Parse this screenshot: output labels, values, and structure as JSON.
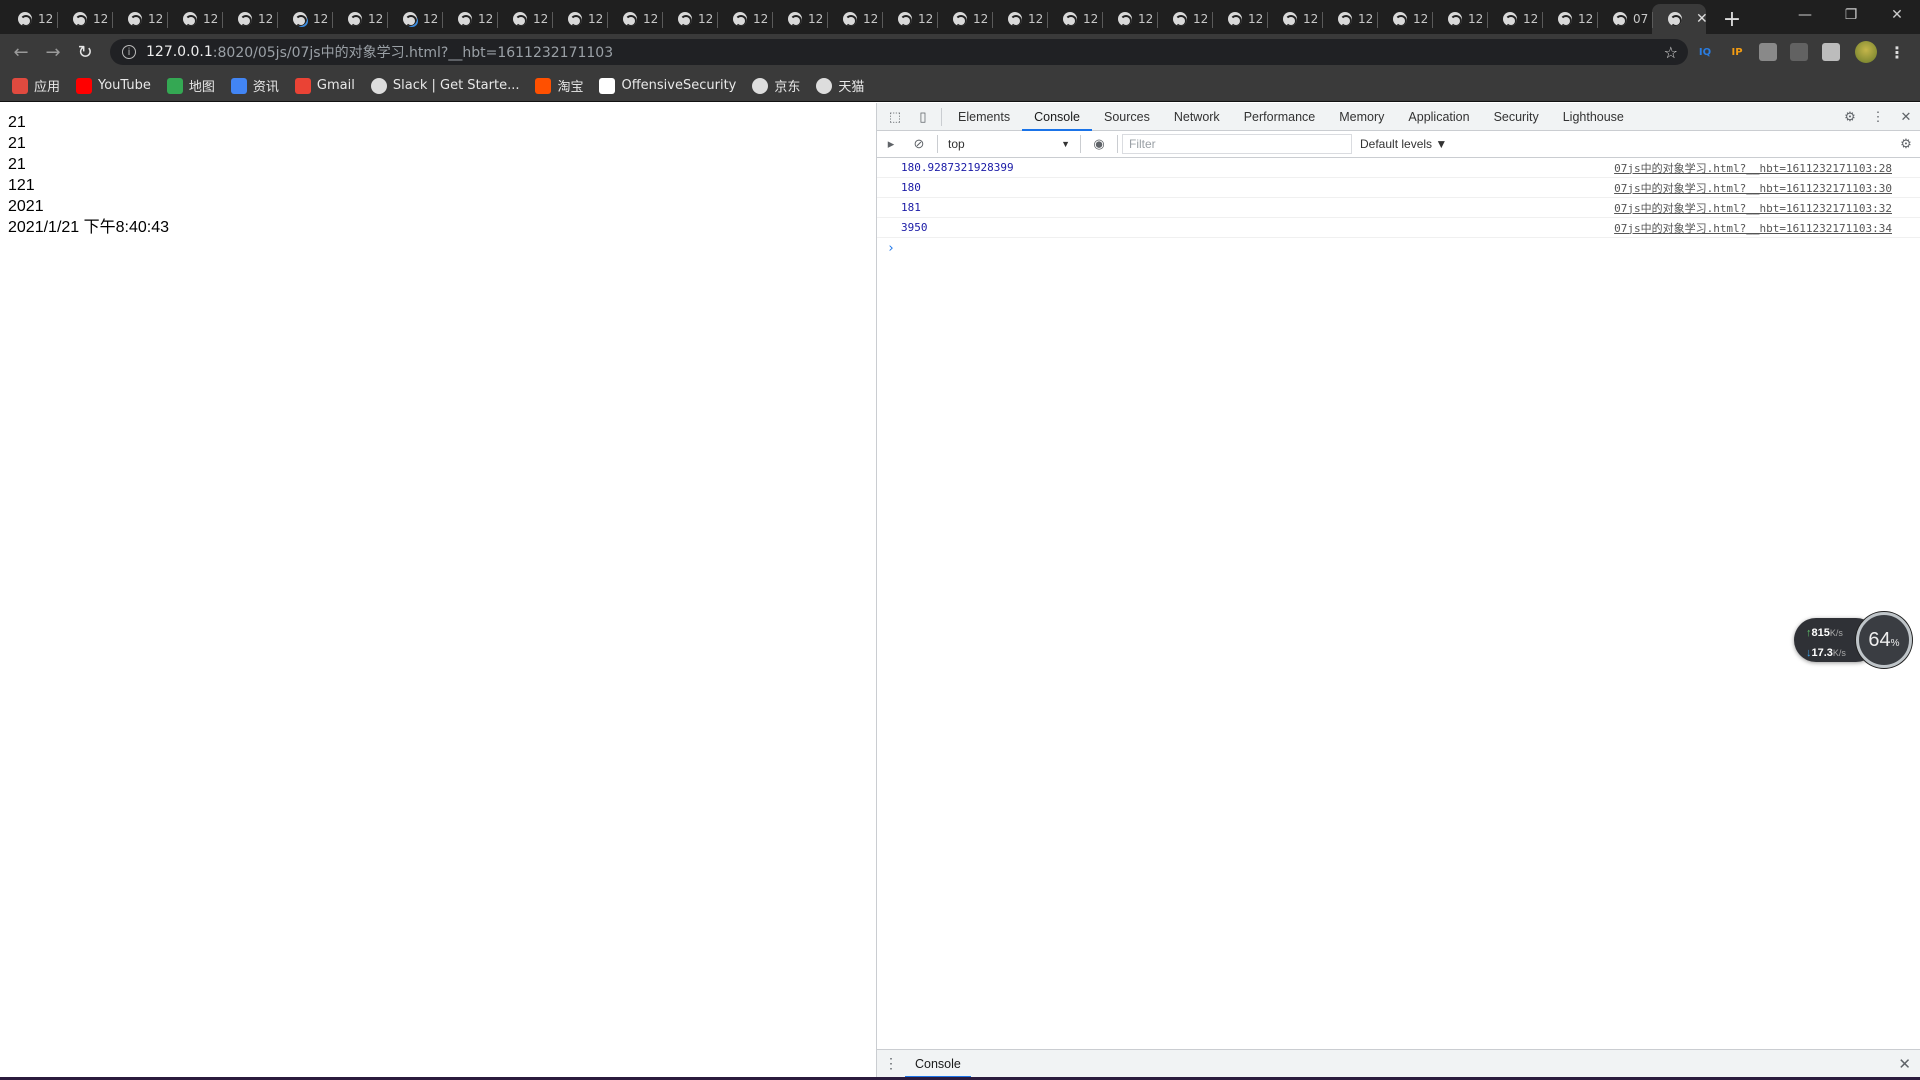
{
  "browser": {
    "tabs": [
      {
        "title": "12",
        "loading": false
      },
      {
        "title": "12",
        "loading": false
      },
      {
        "title": "12",
        "loading": false
      },
      {
        "title": "12",
        "loading": false
      },
      {
        "title": "12",
        "loading": false
      },
      {
        "title": "12",
        "loading": true
      },
      {
        "title": "12",
        "loading": false
      },
      {
        "title": "12",
        "loading": true
      },
      {
        "title": "12",
        "loading": false
      },
      {
        "title": "12",
        "loading": false
      },
      {
        "title": "12",
        "loading": false
      },
      {
        "title": "12",
        "loading": false
      },
      {
        "title": "12",
        "loading": false
      },
      {
        "title": "12",
        "loading": false
      },
      {
        "title": "12",
        "loading": false
      },
      {
        "title": "12",
        "loading": false
      },
      {
        "title": "12",
        "loading": false
      },
      {
        "title": "12",
        "loading": false
      },
      {
        "title": "12",
        "loading": false
      },
      {
        "title": "12",
        "loading": false
      },
      {
        "title": "12",
        "loading": false
      },
      {
        "title": "12",
        "loading": false
      },
      {
        "title": "12",
        "loading": false
      },
      {
        "title": "12",
        "loading": false
      },
      {
        "title": "12",
        "loading": false
      },
      {
        "title": "12",
        "loading": false
      },
      {
        "title": "12",
        "loading": false
      },
      {
        "title": "12",
        "loading": false
      },
      {
        "title": "12",
        "loading": false
      },
      {
        "title": "07",
        "loading": false
      }
    ],
    "active_tab_close": "✕",
    "new_tab": "+",
    "window_controls": {
      "minimize": "—",
      "restore": "❐",
      "close": "✕"
    },
    "url_host": "127.0.0.1",
    "url_path": ":8020/05js/07js中的对象学习.html?__hbt=1611232171103",
    "extensions": [
      {
        "label": "IQ",
        "color": "#2a7de1",
        "icon": "iq-extension-icon"
      },
      {
        "label": "IP",
        "color": "#f39c12",
        "icon": "ip-extension-icon"
      },
      {
        "label": "",
        "color": "#9e9e9e",
        "icon": "screenshot-extension-icon"
      },
      {
        "label": "",
        "color": "#6d6d6d",
        "icon": "camera-extension-icon"
      },
      {
        "label": "",
        "color": "#dddddd",
        "icon": "puzzle-extensions-icon"
      }
    ],
    "bookmarks": [
      {
        "label": "应用",
        "icon": "apps-grid-icon",
        "color": "#e04a3f"
      },
      {
        "label": "YouTube",
        "icon": "youtube-icon",
        "color": "#ff0000"
      },
      {
        "label": "地图",
        "icon": "maps-icon",
        "color": "#34a853"
      },
      {
        "label": "资讯",
        "icon": "news-icon",
        "color": "#4285f4"
      },
      {
        "label": "Gmail",
        "icon": "gmail-icon",
        "color": "#ea4335"
      },
      {
        "label": "Slack | Get Starte...",
        "icon": "globe-icon",
        "color": "#dddddd"
      },
      {
        "label": "淘宝",
        "icon": "taobao-icon",
        "color": "#ff5000"
      },
      {
        "label": "OffensiveSecurity",
        "icon": "offsec-icon",
        "color": "#ffffff"
      },
      {
        "label": "京东",
        "icon": "globe-icon",
        "color": "#dddddd"
      },
      {
        "label": "天猫",
        "icon": "globe-icon",
        "color": "#dddddd"
      }
    ]
  },
  "page": {
    "lines": [
      "21",
      "21",
      "21",
      "121",
      "2021",
      "2021/1/21 下午8:40:43"
    ]
  },
  "devtools": {
    "tabs": [
      "Elements",
      "Console",
      "Sources",
      "Network",
      "Performance",
      "Memory",
      "Application",
      "Security",
      "Lighthouse"
    ],
    "active_tab": "Console",
    "context": "top",
    "filter_placeholder": "Filter",
    "levels": "Default levels ▼",
    "logs": [
      {
        "value": "180.9287321928399",
        "source": "07js中的对象学习.html?__hbt=1611232171103:28"
      },
      {
        "value": "180",
        "source": "07js中的对象学习.html?__hbt=1611232171103:30"
      },
      {
        "value": "181",
        "source": "07js中的对象学习.html?__hbt=1611232171103:32"
      },
      {
        "value": "3950",
        "source": "07js中的对象学习.html?__hbt=1611232171103:34"
      }
    ],
    "prompt": "›",
    "drawer_tab": "Console",
    "accent": "#1a73e8"
  },
  "net_widget": {
    "upload": "815",
    "upload_unit": "K/s",
    "download": "17.3",
    "download_unit": "K/s",
    "percent": "64",
    "percent_unit": "%"
  }
}
